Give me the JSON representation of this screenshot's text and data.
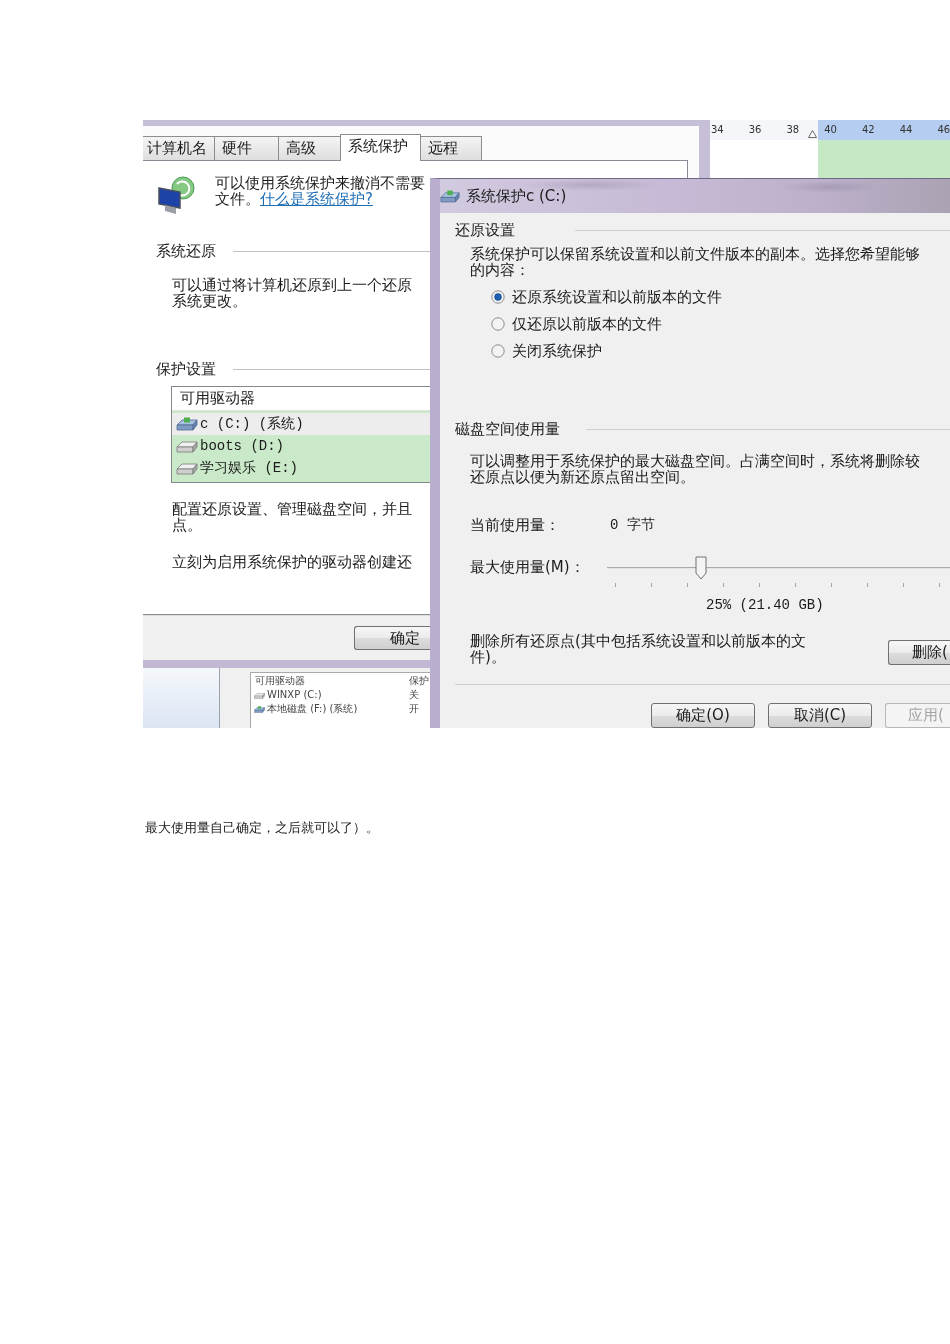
{
  "screenshot": {
    "properties_window": {
      "tabs": [
        {
          "label": "计算机名",
          "selected": false
        },
        {
          "label": "硬件",
          "selected": false
        },
        {
          "label": "高级",
          "selected": false
        },
        {
          "label": "系统保护",
          "selected": true
        },
        {
          "label": "远程",
          "selected": false
        }
      ],
      "intro": {
        "lines": [
          "可以使用系统保护来撤消不需要",
          "文件。"
        ],
        "link": "什么是系统保护?"
      },
      "system_restore": {
        "heading": "系统还原",
        "lines": [
          "可以通过将计算机还原到上一个还原",
          "系统更改。"
        ]
      },
      "protection_settings": {
        "heading": "保护设置",
        "list_header": "可用驱动器",
        "drives": [
          {
            "label": "c (C:) (系统)",
            "kind": "system",
            "selected": true
          },
          {
            "label": "boots (D:)",
            "kind": "disk",
            "selected": false
          },
          {
            "label": "学习娱乐 (E:)",
            "kind": "disk",
            "selected": false
          }
        ],
        "configure_lines": [
          "配置还原设置、管理磁盘空间，并且",
          "点。"
        ],
        "create_text": "立刻为启用系统保护的驱动器创建还"
      },
      "ok_button": "确定"
    },
    "ruler": {
      "labels": [
        "34",
        "36",
        "38",
        "40",
        "42",
        "44",
        "46"
      ]
    },
    "drive_window": {
      "columns": [
        "可用驱动器",
        "保护"
      ],
      "rows": [
        {
          "drive": "WINXP (C:)",
          "kind": "disk",
          "protection": "关"
        },
        {
          "drive": "本地磁盘 (F:) (系统)",
          "kind": "system",
          "protection": "开"
        }
      ]
    },
    "dialog": {
      "title": "系统保护c (C:)",
      "restore_settings": {
        "heading": "还原设置",
        "description": [
          "系统保护可以保留系统设置和以前文件版本的副本。选择您希望能够",
          "的内容："
        ],
        "options": [
          {
            "label": "还原系统设置和以前版本的文件",
            "selected": true
          },
          {
            "label": "仅还原以前版本的文件",
            "selected": false
          },
          {
            "label": "关闭系统保护",
            "selected": false
          }
        ]
      },
      "disk_usage": {
        "heading": "磁盘空间使用量",
        "description": [
          "可以调整用于系统保护的最大磁盘空间。占满空间时，系统将删除较",
          "还原点以便为新还原点留出空间。"
        ],
        "current_label": "当前使用量：",
        "current_value": "0 字节",
        "max_label": "最大使用量(M)：",
        "slider": {
          "level": 0.25
        },
        "max_value": "25% (21.40 GB)",
        "delete_text": [
          "删除所有还原点(其中包括系统设置和以前版本的文",
          "件)。"
        ],
        "delete_button": "删除("
      },
      "buttons": [
        {
          "label": "确定(O)",
          "disabled": false
        },
        {
          "label": "取消(C)",
          "disabled": false
        },
        {
          "label": "应用(",
          "disabled": true
        }
      ]
    }
  },
  "caption": "最大使用量自己确定，之后就可以了）。"
}
